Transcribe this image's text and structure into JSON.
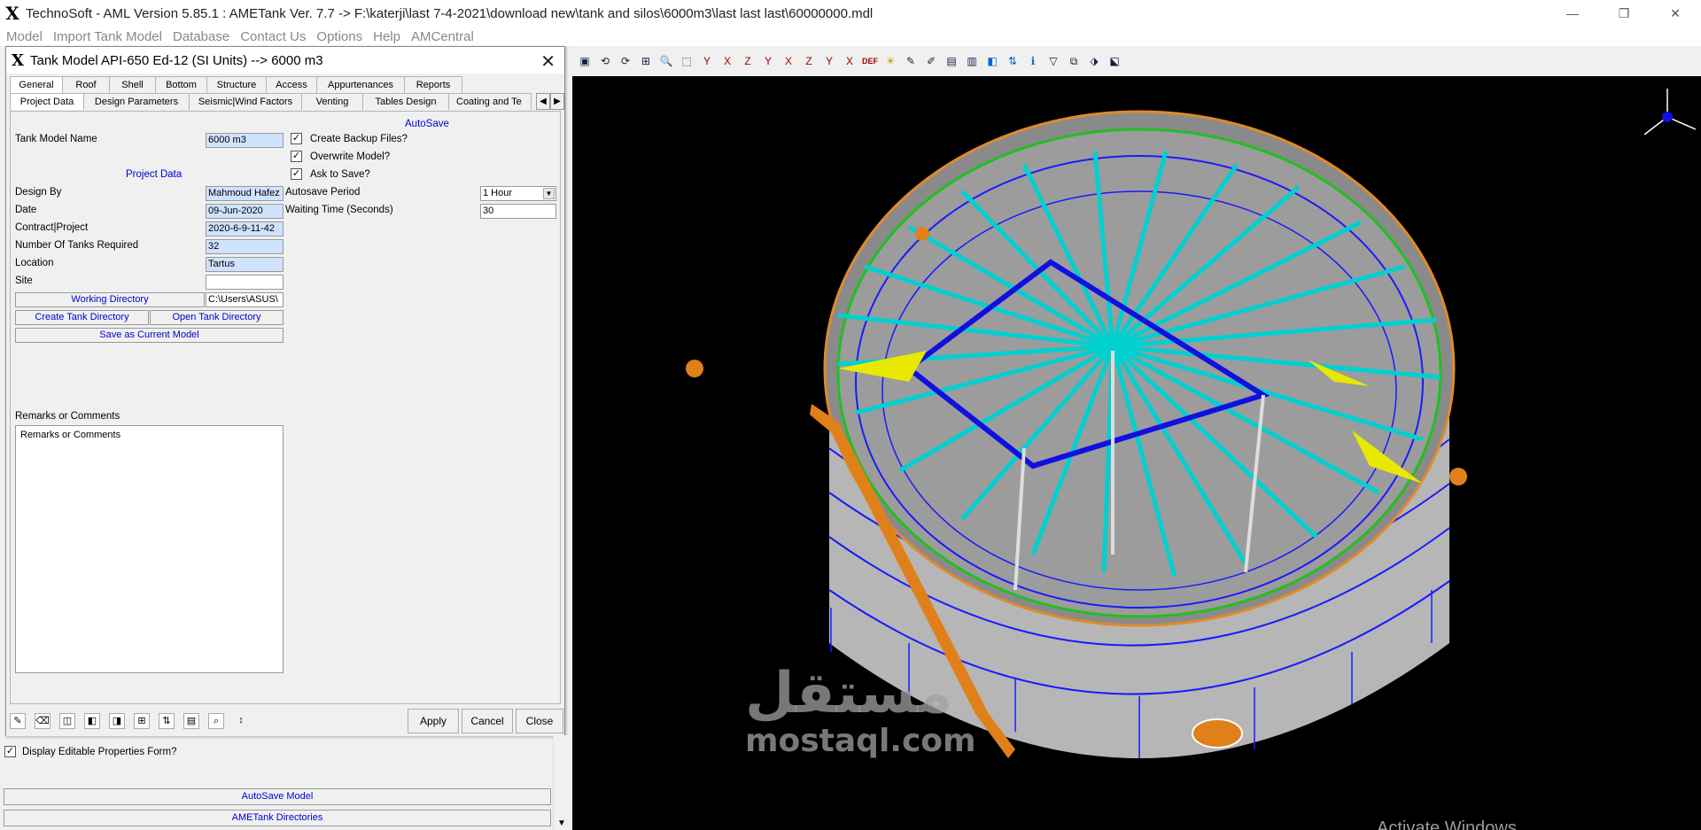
{
  "window": {
    "title": "TechnoSoft - AML Version 5.85.1 : AMETank Ver. 7.7 -> F:\\katerji\\last 7-4-2021\\download new\\tank and silos\\6000m3\\last last last\\60000000.mdl",
    "logo": "X",
    "minimize": "—",
    "maximize": "❐",
    "close": "✕"
  },
  "menu": [
    "Model",
    "Import Tank Model",
    "Database",
    "Contact Us",
    "Options",
    "Help",
    "AMCentral"
  ],
  "dialog": {
    "logo": "X",
    "title": "Tank Model API-650 Ed-12 (SI Units) --> 6000 m3",
    "close": "✕",
    "tabs1": [
      "General",
      "Roof",
      "Shell",
      "Bottom",
      "Structure",
      "Access",
      "Appurtenances",
      "Reports"
    ],
    "tabs2": [
      "Project Data",
      "Design Parameters",
      "Seismic|Wind Factors",
      "Venting",
      "Tables Design",
      "Coating and Te"
    ],
    "tab_prev": "◀",
    "tab_next": "▶",
    "autosave_header": "AutoSave",
    "project_data_header": "Project Data",
    "fields": {
      "tank_model_name_label": "Tank Model Name",
      "tank_model_name": "6000 m3",
      "design_by_label": "Design By",
      "design_by": "Mahmoud Hafez",
      "date_label": "Date",
      "date": "09-Jun-2020",
      "contract_label": "Contract|Project",
      "contract": "2020-6-9-11-42",
      "tanks_required_label": "Number Of Tanks Required",
      "tanks_required": "32",
      "location_label": "Location",
      "location": "Tartus",
      "site_label": "Site",
      "site": "",
      "working_dir_path": "C:\\Users\\ASUS\\"
    },
    "checks": {
      "backup_label": "Create Backup Files?",
      "backup": "✓",
      "overwrite_label": "Overwrite Model?",
      "overwrite": "✓",
      "ask_label": "Ask to Save?",
      "ask": "✓"
    },
    "autosave": {
      "period_label": "Autosave Period",
      "period": "1 Hour",
      "wait_label": "Waiting Time (Seconds)",
      "wait": "30"
    },
    "buttons": {
      "working_dir": "Working Directory",
      "create_dir": "Create Tank Directory",
      "open_dir": "Open Tank Directory",
      "save_current": "Save as Current Model",
      "apply": "Apply",
      "cancel": "Cancel",
      "close": "Close"
    },
    "remarks_label": "Remarks or Comments",
    "remarks_text": "Remarks or Comments"
  },
  "below": {
    "display_editable_label": "Display Editable Properties Form?",
    "display_editable": "✓",
    "autosave_model": "AutoSave Model",
    "ametank_dirs": "AMETank Directories",
    "scroll_down": "▼"
  },
  "toolbar_icons": [
    "▣",
    "⟲",
    "⟳",
    "⊞",
    "🔍",
    "⬚",
    "Y",
    "X",
    "Z",
    "Y",
    "X",
    "Z",
    "Y",
    "X",
    "DEF",
    "☀",
    "✎",
    "✐",
    "▤",
    "▥",
    "◧",
    "⇅",
    "ℹ",
    "▽",
    "⧉",
    "⬗",
    "⬕"
  ],
  "watermark": {
    "arabic": "مستقل",
    "latin": "mostaql.com"
  },
  "activate_text": "Activate Windows",
  "colors": {
    "field_bg": "#cfe3ff",
    "link_blue": "#0000d0",
    "rafter": "#00d0d0",
    "shell": "#b8b8b8",
    "course_line": "#1a1aff"
  }
}
